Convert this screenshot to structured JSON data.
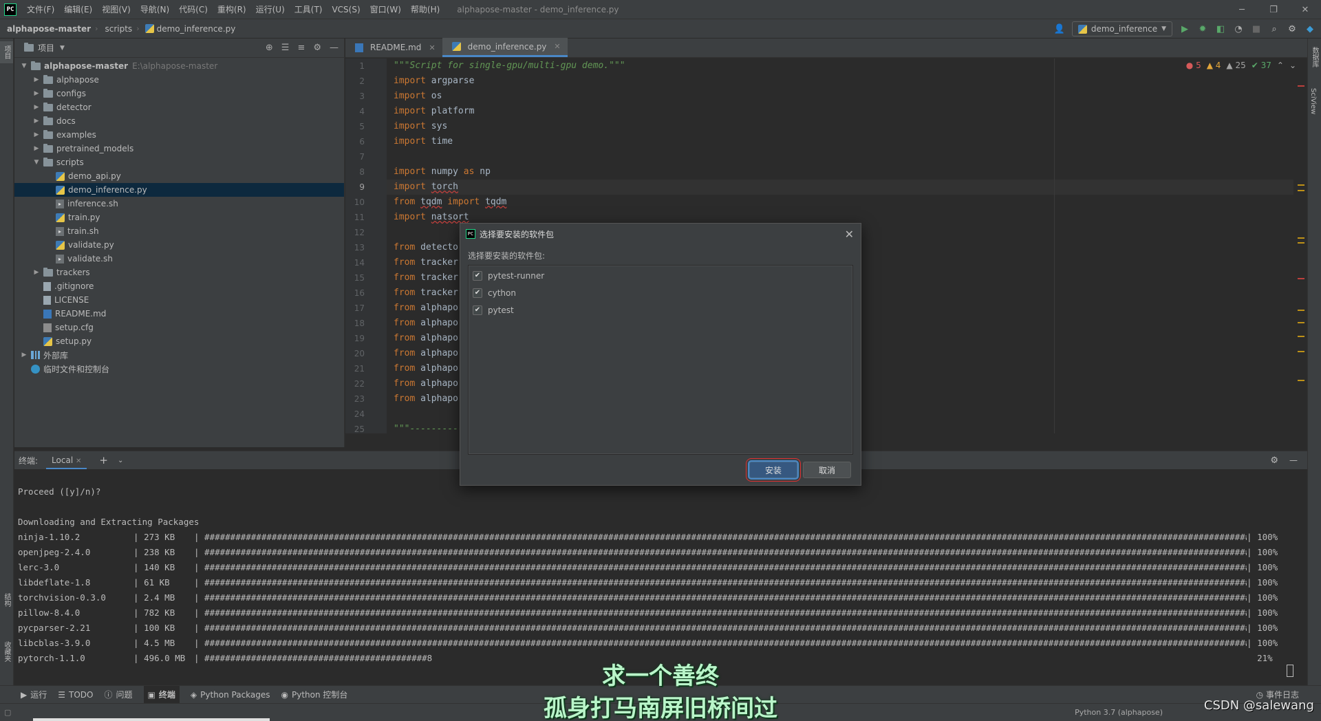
{
  "title_bar": {
    "logo": "PC",
    "menu": [
      "文件(F)",
      "编辑(E)",
      "视图(V)",
      "导航(N)",
      "代码(C)",
      "重构(R)",
      "运行(U)",
      "工具(T)",
      "VCS(S)",
      "窗口(W)",
      "帮助(H)"
    ],
    "window_title": "alphapose-master - demo_inference.py"
  },
  "nav_bar": {
    "breadcrumbs": [
      "alphapose-master",
      "scripts",
      "demo_inference.py"
    ],
    "run_config": "demo_inference"
  },
  "left_strip": {
    "top_label": "项目",
    "bottom_labels": [
      "结构",
      "收藏夹"
    ]
  },
  "right_strip": {
    "labels": [
      "数据库",
      "SciView"
    ]
  },
  "project_panel": {
    "title": "项目",
    "tree": [
      {
        "label": "alphapose-master",
        "hint": "E:\\alphapose-master",
        "depth": 0,
        "kind": "folder",
        "arrow": "down",
        "bold": true
      },
      {
        "label": "alphapose",
        "depth": 1,
        "kind": "folder",
        "arrow": "right"
      },
      {
        "label": "configs",
        "depth": 1,
        "kind": "folder",
        "arrow": "right"
      },
      {
        "label": "detector",
        "depth": 1,
        "kind": "folder",
        "arrow": "right"
      },
      {
        "label": "docs",
        "depth": 1,
        "kind": "folder",
        "arrow": "right"
      },
      {
        "label": "examples",
        "depth": 1,
        "kind": "folder",
        "arrow": "right"
      },
      {
        "label": "pretrained_models",
        "depth": 1,
        "kind": "folder",
        "arrow": "right"
      },
      {
        "label": "scripts",
        "depth": 1,
        "kind": "folder",
        "arrow": "down"
      },
      {
        "label": "demo_api.py",
        "depth": 2,
        "kind": "py"
      },
      {
        "label": "demo_inference.py",
        "depth": 2,
        "kind": "py",
        "selected": true
      },
      {
        "label": "inference.sh",
        "depth": 2,
        "kind": "sh"
      },
      {
        "label": "train.py",
        "depth": 2,
        "kind": "py"
      },
      {
        "label": "train.sh",
        "depth": 2,
        "kind": "sh"
      },
      {
        "label": "validate.py",
        "depth": 2,
        "kind": "py"
      },
      {
        "label": "validate.sh",
        "depth": 2,
        "kind": "sh"
      },
      {
        "label": "trackers",
        "depth": 1,
        "kind": "folder",
        "arrow": "right"
      },
      {
        "label": ".gitignore",
        "depth": 1,
        "kind": "file"
      },
      {
        "label": "LICENSE",
        "depth": 1,
        "kind": "file"
      },
      {
        "label": "README.md",
        "depth": 1,
        "kind": "md"
      },
      {
        "label": "setup.cfg",
        "depth": 1,
        "kind": "cfg"
      },
      {
        "label": "setup.py",
        "depth": 1,
        "kind": "py"
      },
      {
        "label": "外部库",
        "depth": 0,
        "kind": "lib",
        "arrow": "right"
      },
      {
        "label": "临时文件和控制台",
        "depth": 0,
        "kind": "scratch"
      }
    ]
  },
  "editor": {
    "tabs": [
      {
        "label": "README.md",
        "active": false
      },
      {
        "label": "demo_inference.py",
        "active": true
      }
    ],
    "inspections": {
      "errors": "5",
      "warnings": "4",
      "weak_warnings": "25",
      "ok": "37"
    },
    "current_line": 9,
    "lines": [
      [
        {
          "t": "\"\"\"Script for single-gpu/multi-gpu demo.\"\"\"",
          "c": "doc"
        }
      ],
      [
        {
          "t": "import",
          "c": "kw"
        },
        {
          "t": " argparse"
        }
      ],
      [
        {
          "t": "import",
          "c": "kw"
        },
        {
          "t": " os"
        }
      ],
      [
        {
          "t": "import",
          "c": "kw"
        },
        {
          "t": " platform"
        }
      ],
      [
        {
          "t": "import",
          "c": "kw"
        },
        {
          "t": " sys"
        }
      ],
      [
        {
          "t": "import",
          "c": "kw"
        },
        {
          "t": " time"
        }
      ],
      [],
      [
        {
          "t": "import",
          "c": "kw"
        },
        {
          "t": " numpy "
        },
        {
          "t": "as",
          "c": "kw"
        },
        {
          "t": " np"
        }
      ],
      [
        {
          "t": "import",
          "c": "kw"
        },
        {
          "t": " "
        },
        {
          "t": "torch",
          "c": "warn"
        }
      ],
      [
        {
          "t": "from",
          "c": "kw"
        },
        {
          "t": " "
        },
        {
          "t": "tqdm",
          "c": "warn"
        },
        {
          "t": " "
        },
        {
          "t": "import",
          "c": "kw"
        },
        {
          "t": " "
        },
        {
          "t": "tqdm",
          "c": "warn"
        }
      ],
      [
        {
          "t": "import",
          "c": "kw"
        },
        {
          "t": " "
        },
        {
          "t": "natsort",
          "c": "warn"
        }
      ],
      [],
      [
        {
          "t": "from",
          "c": "kw"
        },
        {
          "t": " detecto"
        }
      ],
      [
        {
          "t": "from",
          "c": "kw"
        },
        {
          "t": " tracker"
        }
      ],
      [
        {
          "t": "from",
          "c": "kw"
        },
        {
          "t": " tracker"
        }
      ],
      [
        {
          "t": "from",
          "c": "kw"
        },
        {
          "t": " tracker"
        }
      ],
      [
        {
          "t": "from",
          "c": "kw"
        },
        {
          "t": " alphapo"
        }
      ],
      [
        {
          "t": "from",
          "c": "kw"
        },
        {
          "t": " alphapo"
        }
      ],
      [
        {
          "t": "from",
          "c": "kw"
        },
        {
          "t": " alphapo"
        }
      ],
      [
        {
          "t": "from",
          "c": "kw"
        },
        {
          "t": " alphapo"
        }
      ],
      [
        {
          "t": "from",
          "c": "kw"
        },
        {
          "t": " alphapo"
        }
      ],
      [
        {
          "t": "from",
          "c": "kw"
        },
        {
          "t": " alphapo"
        }
      ],
      [
        {
          "t": "from",
          "c": "kw"
        },
        {
          "t": " alphapo"
        }
      ],
      [],
      [
        {
          "t": "\"\"\"----------",
          "c": "doc"
        }
      ]
    ]
  },
  "terminal": {
    "label": "终端:",
    "tab": "Local",
    "prompt_line": "Proceed ([y]/n)?",
    "section_title": "Downloading and Extracting Packages",
    "packages": [
      {
        "name": "ninja-1.10.2",
        "size": "273 KB",
        "progress": 1.0,
        "pct": "100%"
      },
      {
        "name": "openjpeg-2.4.0",
        "size": "238 KB",
        "progress": 1.0,
        "pct": "100%"
      },
      {
        "name": "lerc-3.0",
        "size": "140 KB",
        "progress": 1.0,
        "pct": "100%"
      },
      {
        "name": "libdeflate-1.8",
        "size": "61 KB",
        "progress": 1.0,
        "pct": "100%"
      },
      {
        "name": "torchvision-0.3.0",
        "size": "2.4 MB",
        "progress": 1.0,
        "pct": "100%"
      },
      {
        "name": "pillow-8.4.0",
        "size": "782 KB",
        "progress": 1.0,
        "pct": "100%"
      },
      {
        "name": "pycparser-2.21",
        "size": "100 KB",
        "progress": 1.0,
        "pct": "100%"
      },
      {
        "name": "libcblas-3.9.0",
        "size": "4.5 MB",
        "progress": 1.0,
        "pct": "100%"
      },
      {
        "name": "pytorch-1.1.0",
        "size": "496.0 MB",
        "progress": 0.21,
        "pct": "21%",
        "tail": "8"
      }
    ]
  },
  "bottom_tools": {
    "items": [
      "运行",
      "TODO",
      "问题",
      "终端",
      "Python Packages",
      "Python 控制台"
    ],
    "active": "终端",
    "event_log": "事件日志"
  },
  "status_bar": {
    "right_text": "Python 3.7 (alphapose)"
  },
  "subtitles": [
    "求一个善终",
    "孤身打马南屏旧桥间过"
  ],
  "watermark": "CSDN @salewang",
  "dialog": {
    "title": "选择要安装的软件包",
    "prompt": "选择要安装的软件包:",
    "packages": [
      {
        "name": "pytest-runner",
        "checked": true
      },
      {
        "name": "cython",
        "checked": true
      },
      {
        "name": "pytest",
        "checked": true
      }
    ],
    "ok_label": "安装",
    "cancel_label": "取消"
  },
  "colors": {
    "accent": "#4a88c7",
    "keyword": "#cc7832",
    "docstring": "#629755",
    "selection": "#0d293e"
  }
}
